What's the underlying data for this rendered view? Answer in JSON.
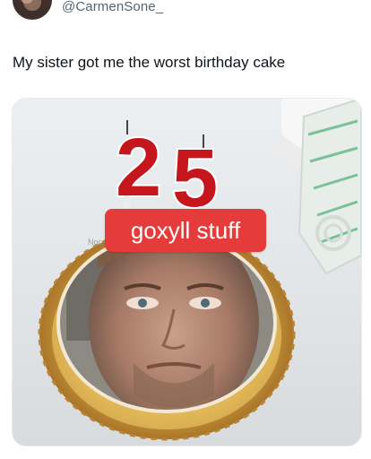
{
  "tweet": {
    "handle": "@CarmenSone_",
    "text": "My sister got me the worst birthday cake"
  },
  "media": {
    "candle_number": "25",
    "sticker_text": "goxyll stuff",
    "edge_text": "Noc",
    "colors": {
      "sticker": "#e63b3b",
      "candle_red": "#c4161c",
      "gold_plate": "#e0b24a",
      "background": "#e5e8ea"
    }
  }
}
